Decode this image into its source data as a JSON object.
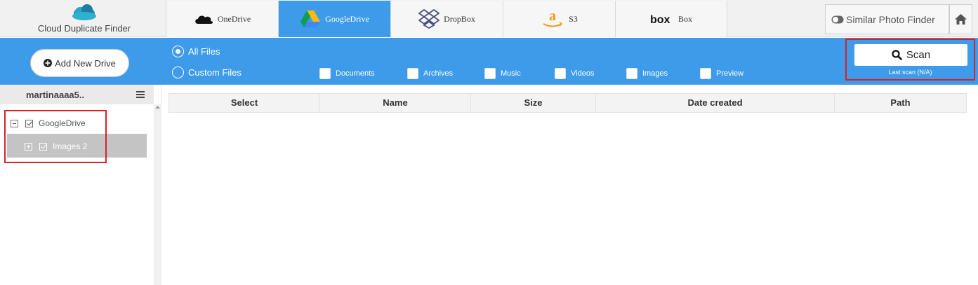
{
  "app": {
    "name": "Cloud Duplicate Finder",
    "logo_icon": "cloud-logo-icon",
    "brand_color": "#3d9be9"
  },
  "tabs": [
    {
      "label": "OneDrive",
      "icon": "onedrive-icon",
      "active": false
    },
    {
      "label": "GoogleDrive",
      "icon": "googledrive-icon",
      "active": true
    },
    {
      "label": "DropBox",
      "icon": "dropbox-icon",
      "active": false
    },
    {
      "label": "S3",
      "icon": "amazon-s3-icon",
      "active": false
    },
    {
      "label": "Box",
      "icon": "box-icon",
      "active": false
    }
  ],
  "header_right": {
    "similar_label": "Similar Photo Finder",
    "similar_icon": "toggle-icon",
    "home_icon": "home-icon"
  },
  "filterbar": {
    "add_drive_label": "Add New Drive",
    "add_drive_icon": "plus-circle-icon",
    "radios": [
      {
        "label": "All Files",
        "checked": true
      },
      {
        "label": "Custom Files",
        "checked": false
      }
    ],
    "checkboxes": [
      {
        "label": "Documents"
      },
      {
        "label": "Archives"
      },
      {
        "label": "Music"
      },
      {
        "label": "Videos"
      },
      {
        "label": "Images"
      },
      {
        "label": "Preview"
      }
    ],
    "scan_label": "Scan",
    "scan_icon": "search-icon",
    "last_scan": "Last scan (N/A)"
  },
  "sidebar": {
    "account": "martinaaaa5..",
    "menu_icon": "hamburger-menu-icon",
    "tree": [
      {
        "label": "GoogleDrive",
        "expanded": true,
        "checked": true
      },
      {
        "label": "Images 2",
        "expanded": false,
        "checked": true,
        "selected": true
      }
    ]
  },
  "table": {
    "columns": [
      "Select",
      "Name",
      "Size",
      "Date created",
      "Path"
    ],
    "rows": []
  }
}
